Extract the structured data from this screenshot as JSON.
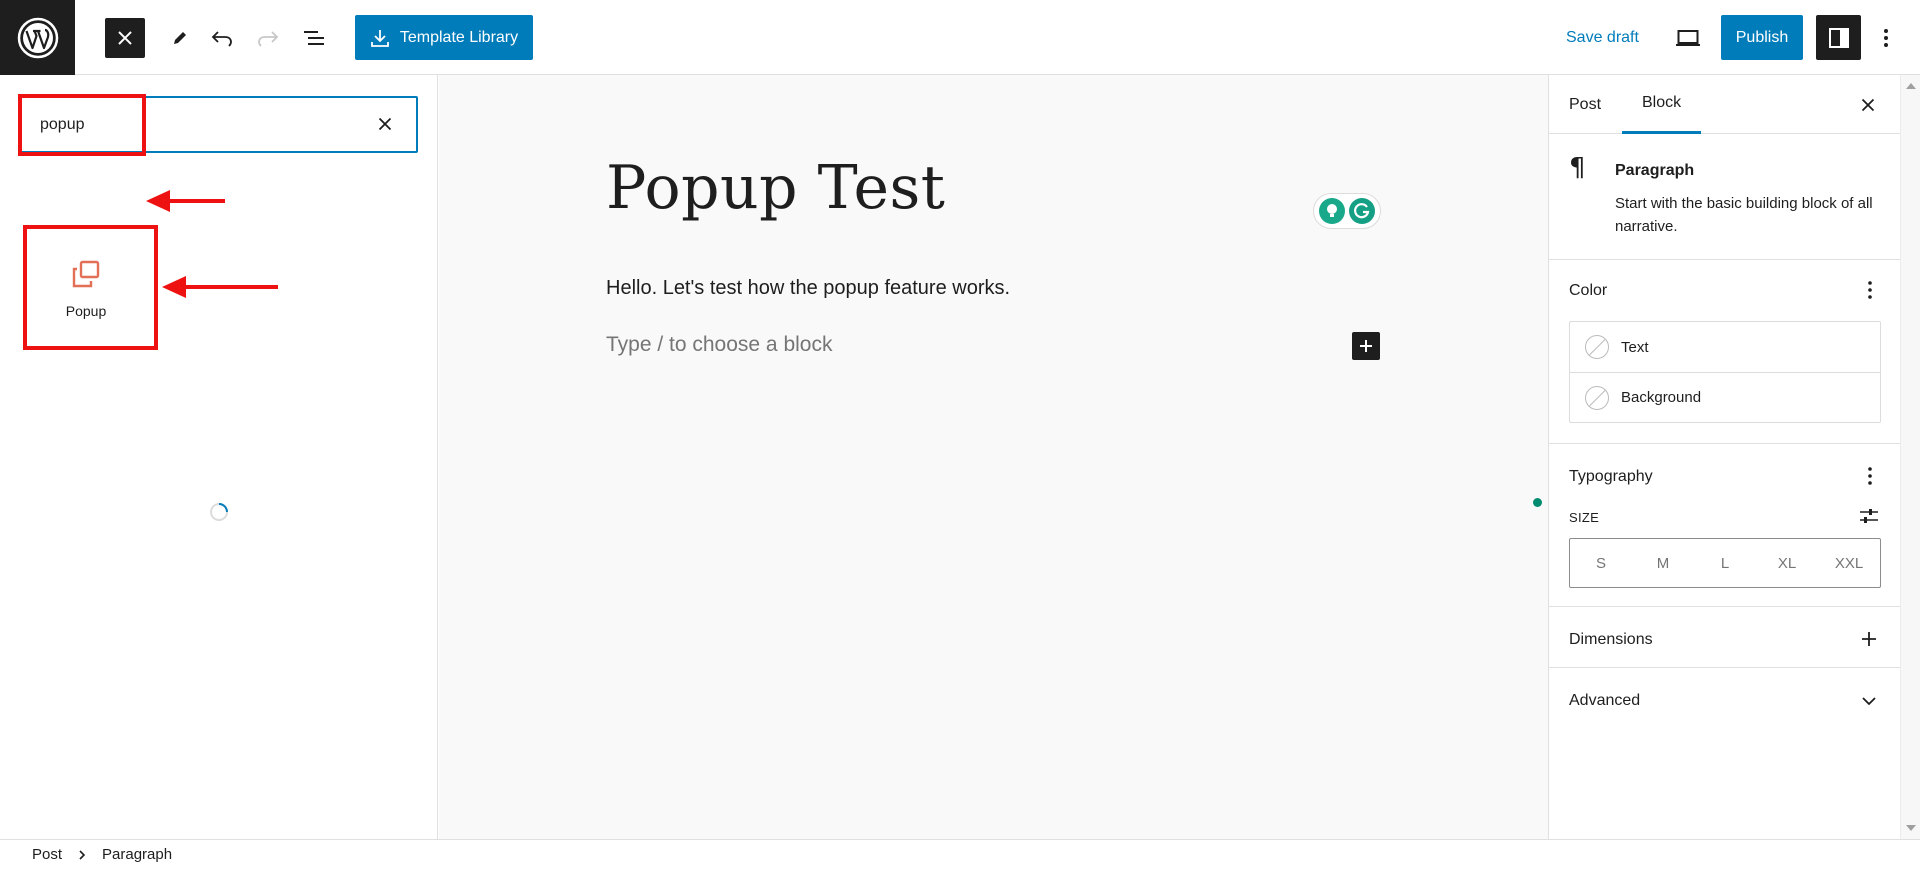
{
  "toolbar": {
    "template_library_label": "Template Library",
    "save_draft_label": "Save draft",
    "publish_label": "Publish"
  },
  "inserter": {
    "search_value": "popup",
    "results": [
      {
        "label": "Popup",
        "icon": "popup-icon"
      }
    ]
  },
  "canvas": {
    "title": "Popup Test",
    "paragraph": "Hello. Let's test how the popup feature works.",
    "placeholder": "Type / to choose a block"
  },
  "sidebar": {
    "tabs": [
      {
        "label": "Post"
      },
      {
        "label": "Block"
      }
    ],
    "active_tab": "Block",
    "block": {
      "name": "Paragraph",
      "description": "Start with the basic building block of all narrative."
    },
    "color": {
      "title": "Color",
      "items": [
        {
          "label": "Text"
        },
        {
          "label": "Background"
        }
      ]
    },
    "typography": {
      "title": "Typography",
      "size_label": "SIZE",
      "sizes": [
        "S",
        "M",
        "L",
        "XL",
        "XXL"
      ]
    },
    "dimensions_title": "Dimensions",
    "advanced_title": "Advanced"
  },
  "breadcrumb": [
    "Post",
    "Paragraph"
  ],
  "colors": {
    "accent": "#007cba",
    "dark": "#1e1e1e",
    "highlight": "#ee1111",
    "popup_icon": "#e26f56",
    "grammarly": "#15a085"
  }
}
